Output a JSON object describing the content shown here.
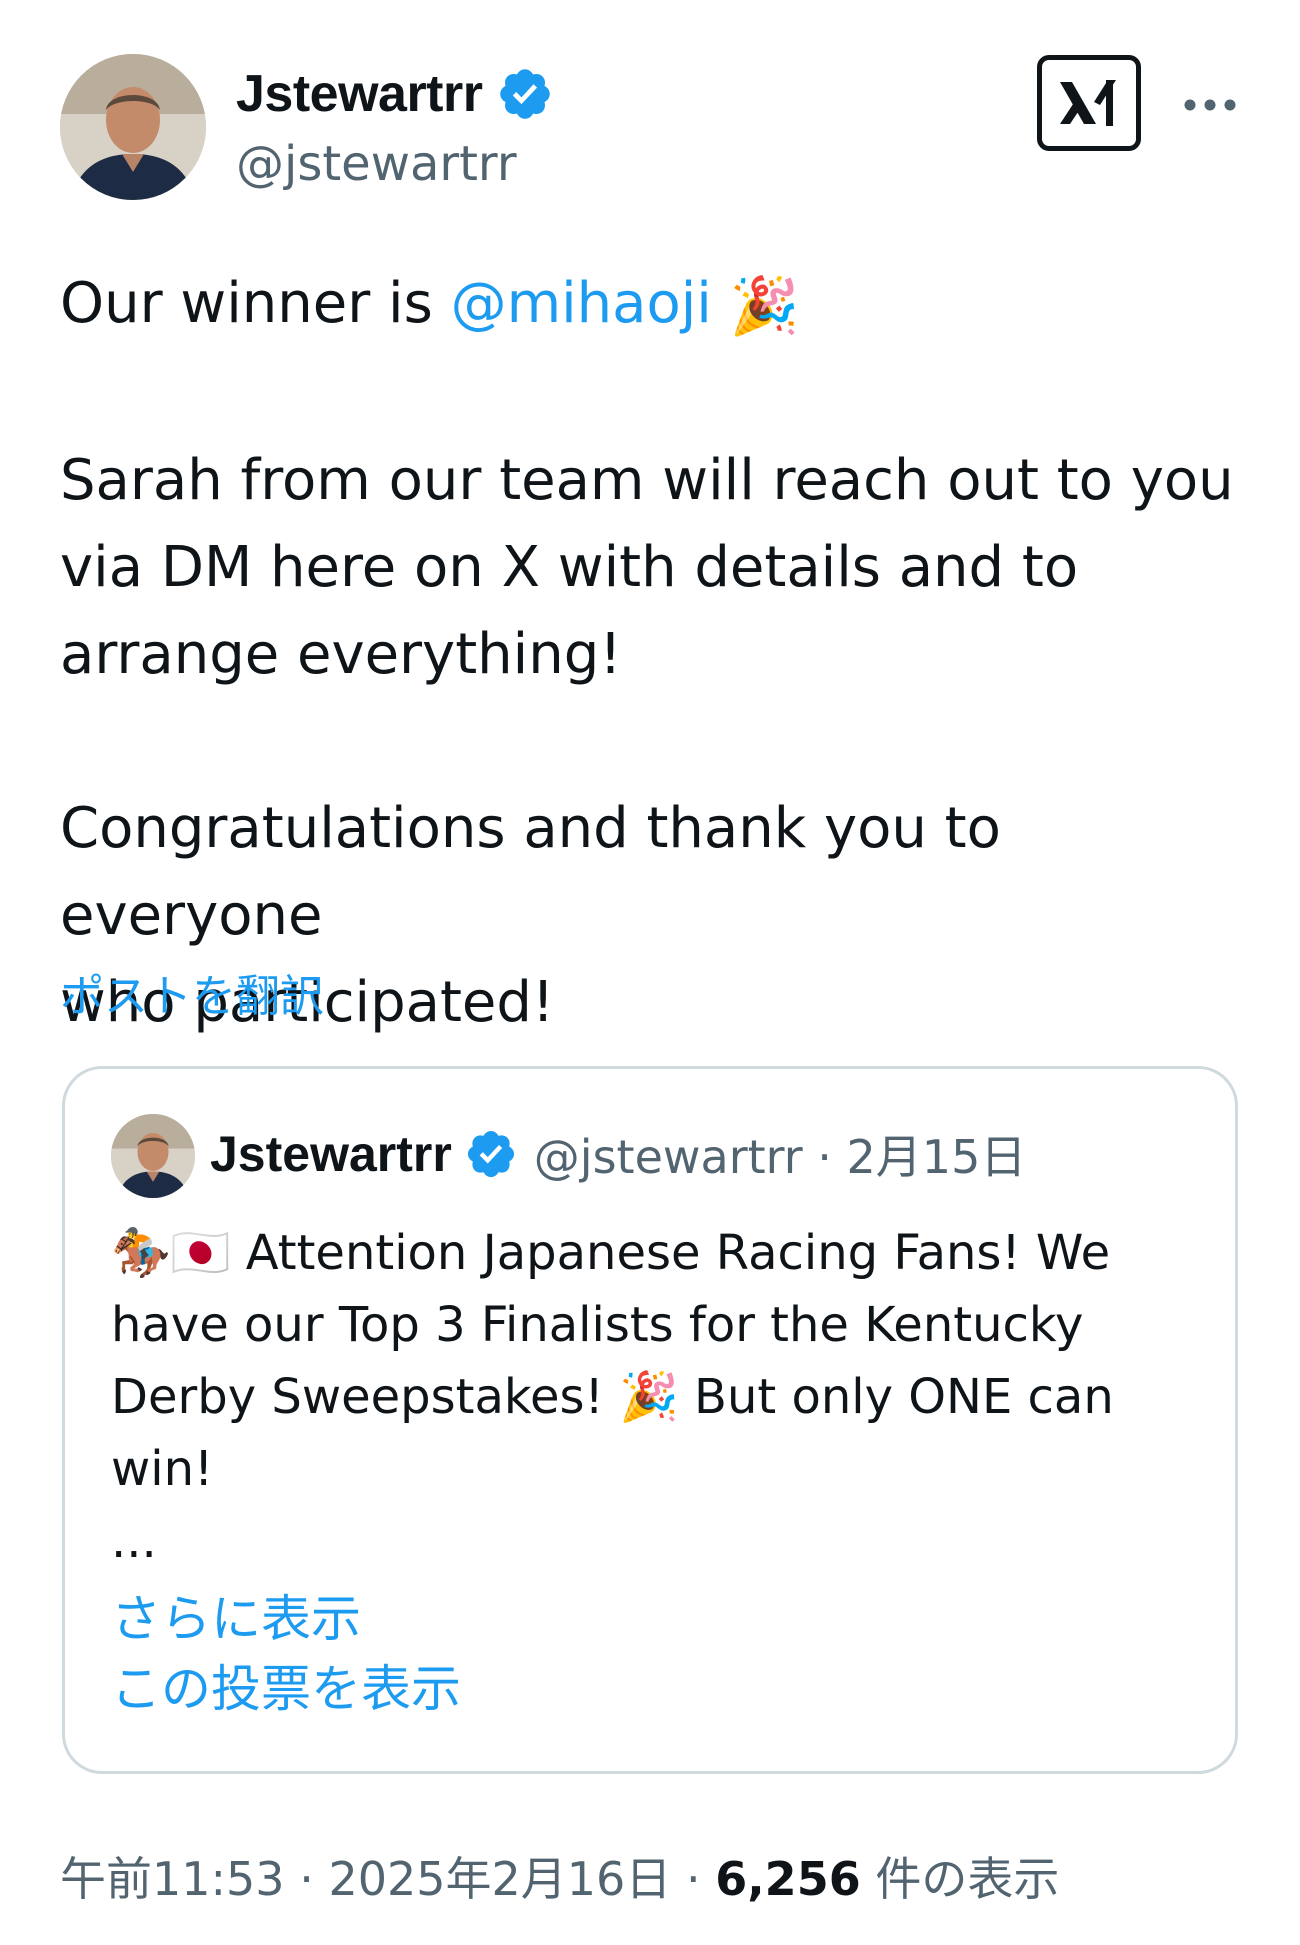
{
  "author": {
    "display_name": "Jstewartrr",
    "handle": "@jstewartrr",
    "verified_icon": "verified-badge-icon",
    "avatar_icon": "avatar"
  },
  "header": {
    "brand_icon": "xai-logo-icon",
    "more_icon": "more-options-icon"
  },
  "tweet": {
    "line1_prefix": "Our winner is ",
    "mention": "@mihaoji",
    "party_emoji": "🎉",
    "paragraph2": "Sarah from our team will reach out to you\nvia DM here on X with details and to\narrange everything!",
    "paragraph3": "Congratulations and thank you to everyone\nwho participated!",
    "translate_label": "ポストを翻訳"
  },
  "quoted_tweet": {
    "display_name": "Jstewartrr",
    "handle": "@jstewartrr",
    "separator": " · ",
    "date": "2月15日",
    "emoji_horse": "🏇",
    "emoji_flag": "🇯🇵",
    "text_part1": "Attention Japanese Racing Fans! We have our Top 3 Finalists for the Kentucky Derby Sweepstakes!",
    "emoji_party": "🎉",
    "text_part2": "But only ONE can win!",
    "ellipsis": "...",
    "show_more": "さらに表示",
    "show_poll": "この投票を表示"
  },
  "footer": {
    "time": "午前11:53",
    "separator": " · ",
    "date": "2025年2月16日",
    "views_count": "6,256",
    "views_label": "件の表示"
  },
  "colors": {
    "link": "#1d9bf0",
    "text": "#0f1419",
    "secondary": "#536471",
    "border": "#cfd9de"
  }
}
